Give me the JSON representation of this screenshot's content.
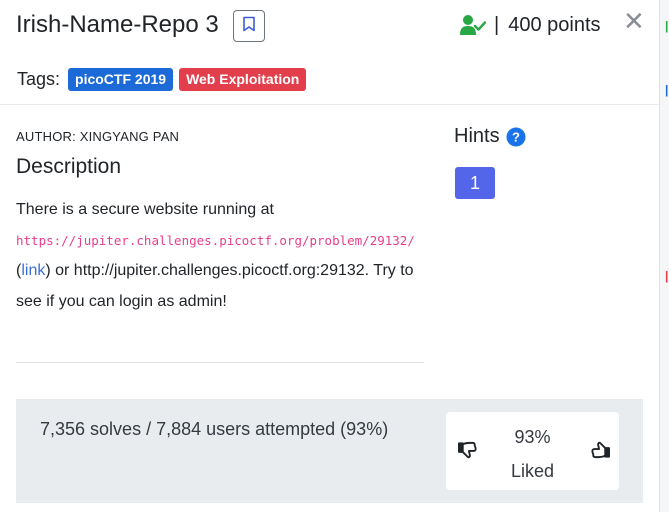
{
  "challenge": {
    "title": "Irish-Name-Repo 3",
    "points_separator": "|",
    "points": "400 points",
    "tags_label": "Tags:",
    "tags": [
      "picoCTF 2019",
      "Web Exploitation"
    ],
    "author": "AUTHOR: XINGYANG PAN",
    "description_heading": "Description",
    "description": {
      "intro": "There is a secure website running at",
      "url_code": "https://jupiter.challenges.picoctf.org/problem/29132/",
      "paren_open": "(",
      "link_text": "link",
      "paren_close_or": ") or",
      "plain_url": "http://jupiter.challenges.picoctf.org:29132.",
      "rest": "Try to see if you can login as admin!"
    },
    "hints_heading": "Hints",
    "hints": [
      "1"
    ],
    "solves_text": "7,356 solves / 7,884 users attempted (93%)",
    "liked_percent": "93%",
    "liked_label": "Liked"
  },
  "colors": {
    "tag_blue": "#1b6ad7",
    "tag_red": "#e23e4c",
    "hint_button": "#5365e8",
    "solved_check": "#28a745",
    "code_pink": "#e83e8c"
  },
  "icons": {
    "bookmark": "bookmark-icon",
    "solved": "user-check-icon",
    "close": "close-icon",
    "help": "question-circle-icon",
    "dislike": "thumbs-down-icon",
    "like": "thumbs-up-icon"
  }
}
